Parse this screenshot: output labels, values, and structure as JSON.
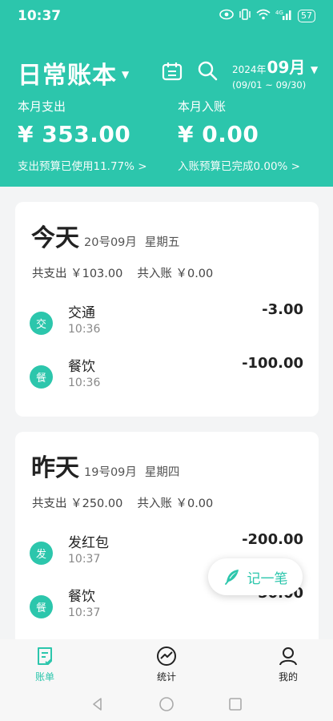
{
  "status": {
    "time": "10:37",
    "signal_label": "4G",
    "battery": "57"
  },
  "header": {
    "app_title": "日常账本",
    "year": "2024年",
    "month": "09月",
    "range": "(09/01 ~ 09/30)"
  },
  "summary": {
    "expense_label": "本月支出",
    "expense_amount": "¥ 353.00",
    "expense_budget": "支出预算已使用11.77% >",
    "income_label": "本月入账",
    "income_amount": "¥ 0.00",
    "income_budget": "入账预算已完成0.00% >"
  },
  "days": [
    {
      "title": "今天",
      "date": "20号09月",
      "weekday": "星期五",
      "total_expense": "共支出 ￥103.00",
      "total_income": "共入账 ￥0.00",
      "entries": [
        {
          "badge": "交",
          "name": "交通",
          "time": "10:36",
          "amount": "-3.00"
        },
        {
          "badge": "餐",
          "name": "餐饮",
          "time": "10:36",
          "amount": "-100.00"
        }
      ]
    },
    {
      "title": "昨天",
      "date": "19号09月",
      "weekday": "星期四",
      "total_expense": "共支出 ￥250.00",
      "total_income": "共入账 ￥0.00",
      "entries": [
        {
          "badge": "发",
          "name": "发红包",
          "time": "10:37",
          "amount": "-200.00"
        },
        {
          "badge": "餐",
          "name": "餐饮",
          "time": "10:37",
          "amount": "-50.00"
        }
      ]
    }
  ],
  "fab": {
    "label": "记一笔"
  },
  "nav": {
    "items": [
      {
        "label": "账单",
        "icon": "bill-icon"
      },
      {
        "label": "统计",
        "icon": "stats-icon"
      },
      {
        "label": "我的",
        "icon": "profile-icon"
      }
    ]
  },
  "colors": {
    "accent": "#2cc6ac"
  }
}
